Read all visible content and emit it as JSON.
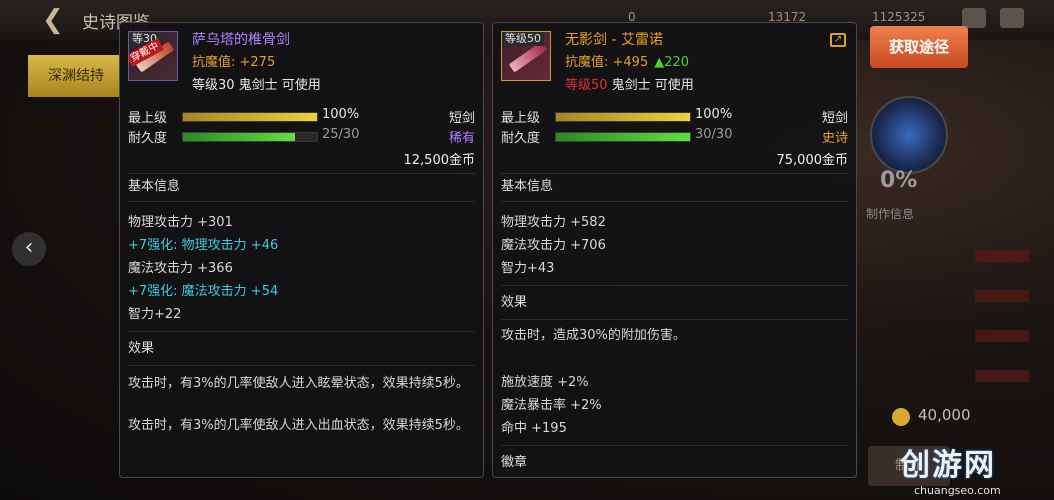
{
  "topbar": {
    "title": "史诗图鉴",
    "res1": "0",
    "res2": "13172",
    "res3": "1125325"
  },
  "left_tab": {
    "label": "深渊结持"
  },
  "colors": {
    "purple": "#b080ff",
    "gold": "#e0a030",
    "green": "#50d030",
    "blue": "#40c8e0",
    "red": "#e03030"
  },
  "item1": {
    "thumb_level": "等30",
    "equipped_tag": "穿戴中",
    "name": "萨乌塔的椎骨剑",
    "anti_magic": "抗魔值: +275",
    "requirement": "等级30 鬼剑士 可使用",
    "max_level_label": "最上级",
    "max_level_value": "100%",
    "max_level_fill": 1.0,
    "durability_label": "耐久度",
    "durability_value": "25/30",
    "durability_fill": 0.833,
    "type": "短剑",
    "rarity": "稀有",
    "price": "12,500金币",
    "basic_info_label": "基本信息",
    "stats": [
      {
        "text": "物理攻击力 +301",
        "style": "normal"
      },
      {
        "text": "+7强化:  物理攻击力 +46",
        "style": "blue"
      },
      {
        "text": "魔法攻击力 +366",
        "style": "normal"
      },
      {
        "text": "+7强化:  魔法攻击力 +54",
        "style": "blue"
      },
      {
        "text": "智力+22",
        "style": "normal"
      }
    ],
    "effect_label": "效果",
    "effects": [
      "攻击时，有3%的几率使敌人进入眩晕状态，效果持续5秒。",
      "攻击时，有3%的几率使敌人进入出血状态，效果持续5秒。"
    ]
  },
  "item2": {
    "thumb_level": "等级50",
    "name": "无影剑 - 艾雷诺",
    "anti_magic": "抗魔值: +495",
    "anti_magic_up": "▲220",
    "requirement_level": "等级50",
    "requirement_rest": " 鬼剑士 可使用",
    "max_level_label": "最上级",
    "max_level_value": "100%",
    "max_level_fill": 1.0,
    "durability_label": "耐久度",
    "durability_value": "30/30",
    "durability_fill": 1.0,
    "type": "短剑",
    "rarity": "史诗",
    "price": "75,000金币",
    "basic_info_label": "基本信息",
    "stats": [
      {
        "text": "物理攻击力 +582"
      },
      {
        "text": "魔法攻击力 +706"
      },
      {
        "text": "智力+43"
      }
    ],
    "effect_label": "效果",
    "effect_main": "攻击时，造成30%的附加伤害。",
    "extra_stats": [
      "施放速度 +2%",
      "魔法暴击率 +2%",
      "命中 +195"
    ],
    "emblem_label": "徽章"
  },
  "right": {
    "get_button": "获取途径",
    "craft_percent": "0%",
    "craft_info": "制作信息",
    "cost": "40,000",
    "craft_button": "制作"
  },
  "watermark": {
    "main": "创游网",
    "sub": "chuangseo.com"
  }
}
